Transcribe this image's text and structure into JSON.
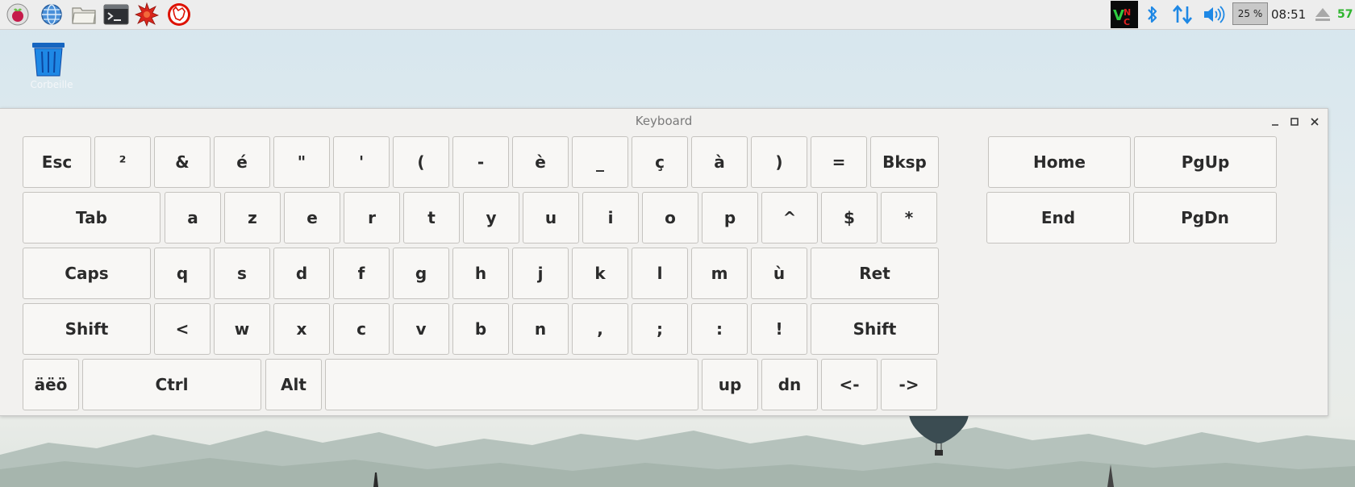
{
  "taskbar": {
    "launchers": [
      {
        "icon": "raspberry-menu-icon"
      },
      {
        "icon": "web-browser-icon"
      },
      {
        "icon": "file-manager-icon"
      },
      {
        "icon": "terminal-icon"
      },
      {
        "icon": "mathematica-icon"
      },
      {
        "icon": "wolfram-icon"
      }
    ],
    "tray": {
      "vnc": "VNC",
      "cpu_usage": "25 %",
      "clock": "08:51",
      "temperature": "57"
    }
  },
  "desktop": {
    "trash_label": "Corbeille"
  },
  "keyboard_window": {
    "title": "Keyboard",
    "rows": [
      [
        "Esc",
        "²",
        "&",
        "é",
        "\"",
        "'",
        "(",
        "-",
        "è",
        "_",
        "ç",
        "à",
        ")",
        "=",
        "Bksp"
      ],
      [
        "Tab",
        "a",
        "z",
        "e",
        "r",
        "t",
        "y",
        "u",
        "i",
        "o",
        "p",
        "^",
        "$",
        "*"
      ],
      [
        "Caps",
        "q",
        "s",
        "d",
        "f",
        "g",
        "h",
        "j",
        "k",
        "l",
        "m",
        "ù",
        "Ret"
      ],
      [
        "Shift",
        "<",
        "w",
        "x",
        "c",
        "v",
        "b",
        "n",
        ",",
        ";",
        ":",
        "!",
        "Shift"
      ],
      [
        "äëö",
        "Ctrl",
        "Alt",
        "",
        "up",
        "dn",
        "<-",
        "->"
      ]
    ],
    "nav_keys": [
      [
        "Home",
        "PgUp"
      ],
      [
        "End",
        "PgDn"
      ]
    ]
  },
  "colors": {
    "taskbar_bg": "#ededed",
    "window_bg": "#f2f1ef",
    "key_bg": "#f8f7f5",
    "accent_blue": "#1e88e5",
    "temp_green": "#2fb52f"
  }
}
